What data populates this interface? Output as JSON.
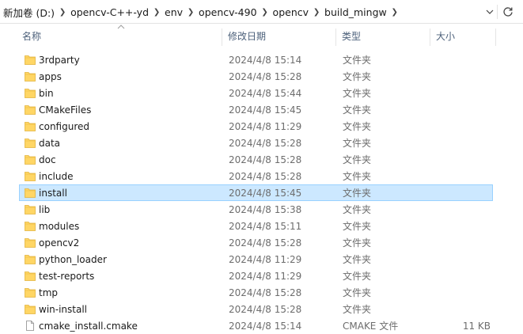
{
  "breadcrumb": [
    "新加卷 (D:)",
    "opencv-C++-yd",
    "env",
    "opencv-490",
    "opencv",
    "build_mingw"
  ],
  "columns": {
    "name": "名称",
    "date": "修改日期",
    "type": "类型",
    "size": "大小"
  },
  "rows": [
    {
      "name": "3rdparty",
      "date": "2024/4/8 15:14",
      "type": "文件夹",
      "size": "",
      "icon": "folder-icon"
    },
    {
      "name": "apps",
      "date": "2024/4/8 15:28",
      "type": "文件夹",
      "size": "",
      "icon": "folder-icon"
    },
    {
      "name": "bin",
      "date": "2024/4/8 15:44",
      "type": "文件夹",
      "size": "",
      "icon": "folder-icon"
    },
    {
      "name": "CMakeFiles",
      "date": "2024/4/8 15:45",
      "type": "文件夹",
      "size": "",
      "icon": "folder-icon"
    },
    {
      "name": "configured",
      "date": "2024/4/8 11:29",
      "type": "文件夹",
      "size": "",
      "icon": "folder-icon"
    },
    {
      "name": "data",
      "date": "2024/4/8 15:28",
      "type": "文件夹",
      "size": "",
      "icon": "folder-icon"
    },
    {
      "name": "doc",
      "date": "2024/4/8 15:28",
      "type": "文件夹",
      "size": "",
      "icon": "folder-icon"
    },
    {
      "name": "include",
      "date": "2024/4/8 15:28",
      "type": "文件夹",
      "size": "",
      "icon": "folder-icon"
    },
    {
      "name": "install",
      "date": "2024/4/8 15:45",
      "type": "文件夹",
      "size": "",
      "icon": "folder-icon",
      "selected": true
    },
    {
      "name": "lib",
      "date": "2024/4/8 15:38",
      "type": "文件夹",
      "size": "",
      "icon": "folder-icon"
    },
    {
      "name": "modules",
      "date": "2024/4/8 15:11",
      "type": "文件夹",
      "size": "",
      "icon": "folder-icon"
    },
    {
      "name": "opencv2",
      "date": "2024/4/8 15:28",
      "type": "文件夹",
      "size": "",
      "icon": "folder-icon"
    },
    {
      "name": "python_loader",
      "date": "2024/4/8 11:29",
      "type": "文件夹",
      "size": "",
      "icon": "folder-icon"
    },
    {
      "name": "test-reports",
      "date": "2024/4/8 11:29",
      "type": "文件夹",
      "size": "",
      "icon": "folder-icon"
    },
    {
      "name": "tmp",
      "date": "2024/4/8 15:28",
      "type": "文件夹",
      "size": "",
      "icon": "folder-icon"
    },
    {
      "name": "win-install",
      "date": "2024/4/8 15:28",
      "type": "文件夹",
      "size": "",
      "icon": "folder-icon"
    },
    {
      "name": "cmake_install.cmake",
      "date": "2024/4/8 15:14",
      "type": "CMAKE 文件",
      "size": "11 KB",
      "icon": "file-icon"
    }
  ],
  "colors": {
    "selection_bg": "#cce8ff",
    "selection_border": "#99d1ff",
    "folder": "#ffd665",
    "header_text": "#4c607a"
  }
}
